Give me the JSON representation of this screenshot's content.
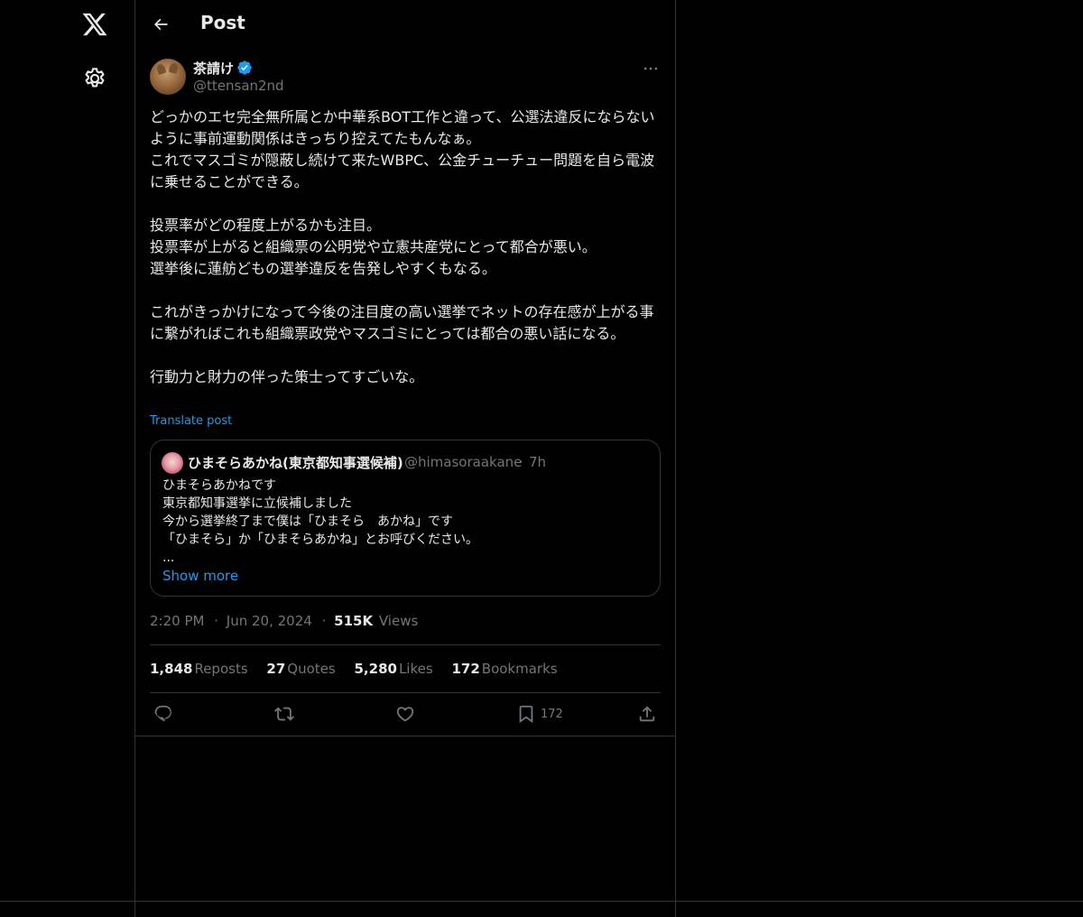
{
  "topbar": {
    "title": "Post"
  },
  "post": {
    "author_name": "茶請け",
    "handle": "@ttensan2nd",
    "body": "どっかのエセ完全無所属とか中華系BOT工作と違って、公選法違反にならないように事前運動関係はきっちり控えてたもんなぁ。\nこれでマスゴミが隠蔽し続けて来たWBPC、公金チューチュー問題を自ら電波に乗せることができる。\n\n投票率がどの程度上がるかも注目。\n投票率が上がると組織票の公明党や立憲共産党にとって都合が悪い。\n選挙後に蓮舫どもの選挙違反を告発しやすくもなる。\n\nこれがきっかけになって今後の注目度の高い選挙でネットの存在感が上がる事に繋がればこれも組織票政党やマスゴミにとっては都合の悪い話になる。\n\n行動力と財力の伴った策士ってすごいな。",
    "translate_label": "Translate post",
    "time": "2:20 PM",
    "date": "Jun 20, 2024",
    "views_count": "515K",
    "views_label": "Views",
    "stats": [
      {
        "count": "1,848",
        "label": "Reposts"
      },
      {
        "count": "27",
        "label": "Quotes"
      },
      {
        "count": "5,280",
        "label": "Likes"
      },
      {
        "count": "172",
        "label": "Bookmarks"
      }
    ],
    "bookmark_count": "172"
  },
  "quote": {
    "name": "ひまそらあかね(東京都知事選候補)",
    "handle": "@himasoraakane",
    "dot": "·",
    "time": "7h",
    "text": "ひまそらあかねです\n東京都知事選挙に立候補しました\n今から選挙終了まで僕は「ひまそら　あかね」です\n「ひまそら」か「ひまそらあかね」とお呼びください。\n...",
    "show_more": "Show more"
  },
  "meta_dot": "·",
  "icons": {
    "logo": "x-logo-icon",
    "settings": "gear-icon",
    "back": "arrow-left-icon",
    "verified": "verified-badge-icon",
    "more": "more-horizontal-icon",
    "reply": "reply-icon",
    "repost": "repost-icon",
    "like": "heart-icon",
    "bookmark": "bookmark-icon",
    "share": "share-icon"
  },
  "colors": {
    "background": "#000000",
    "text": "#e7e9ea",
    "secondary": "#71767b",
    "accent": "#1d9bf0",
    "border": "#2f3336"
  }
}
